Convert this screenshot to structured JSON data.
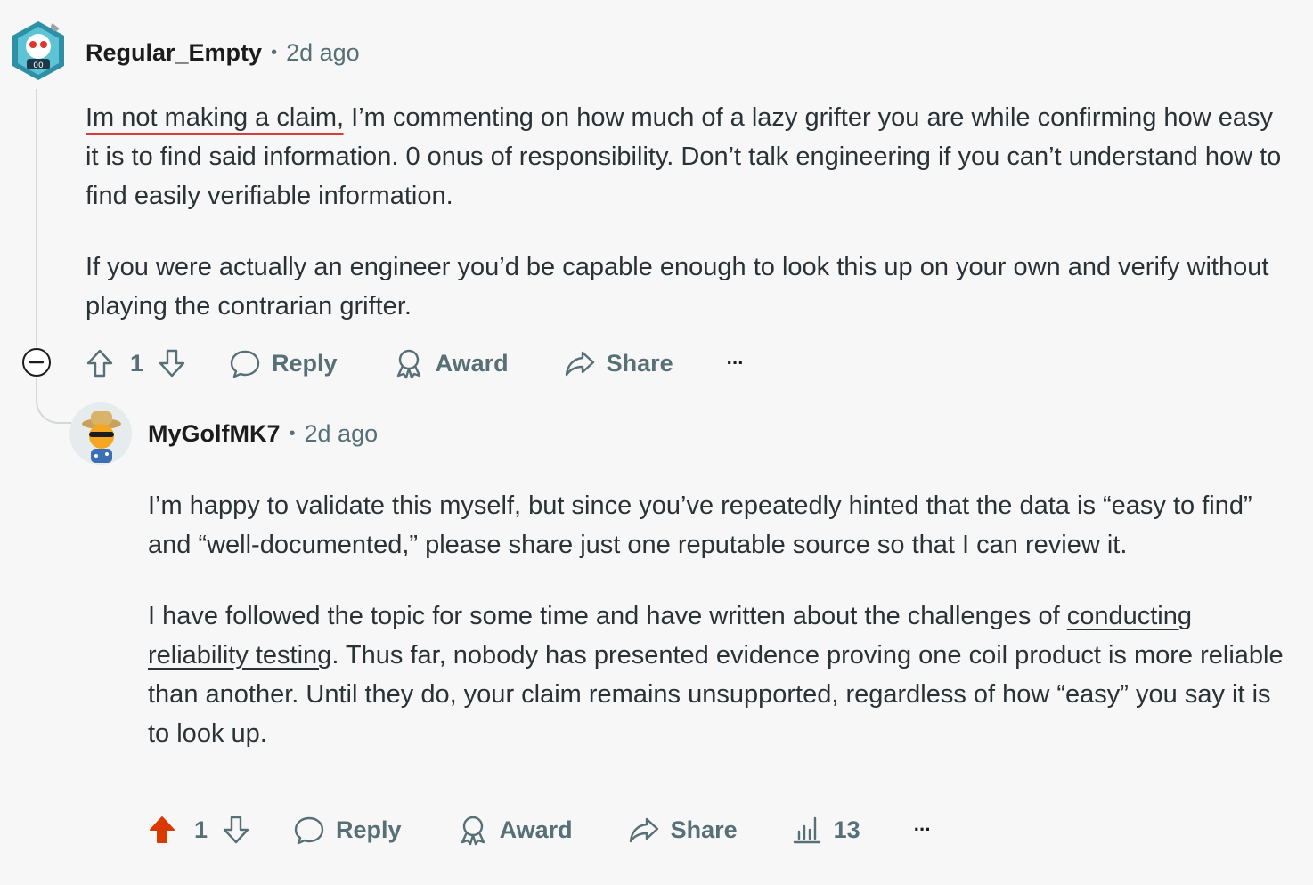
{
  "comments": [
    {
      "author": "Regular_Empty",
      "age": "2d ago",
      "paragraph1_claim": "Im not making a claim,",
      "paragraph1_rest": " I’m commenting on how much of a lazy grifter you are while confirming how easy it is to find said information. 0 onus of responsibility. Don’t talk engineering if you can’t understand how to find easily verifiable information.",
      "paragraph2": "If you were actually an engineer you’d be capable enough to look this up on your own and verify without playing the contrarian grifter.",
      "vote_count": "1",
      "reply_label": "Reply",
      "award_label": "Award",
      "share_label": "Share",
      "more_label": "···"
    },
    {
      "author": "MyGolfMK7",
      "age": "2d ago",
      "paragraph1": "I’m happy to validate this myself, but since you’ve repeatedly hinted that the data is “easy to find” and “well-documented,” please share just one reputable source so that I can review it.",
      "paragraph2_before": "I have followed the topic for some time and have written about the challenges of ",
      "paragraph2_link": "conducting reliability testing",
      "paragraph2_after": ". Thus far, nobody has presented evidence proving one coil product is more reliable than another. Until they do, your claim remains unsupported, regardless of how “easy” you say it is to look up.",
      "vote_count": "1",
      "upvoted": true,
      "reply_label": "Reply",
      "award_label": "Award",
      "share_label": "Share",
      "insights_count": "13",
      "more_label": "···"
    }
  ],
  "colors": {
    "upvote_active": "#d93a00",
    "meta_gray": "#576f76",
    "thread_line": "#d5d8da",
    "claim_underline": "#d93a3a"
  },
  "icons": [
    "collapse-icon",
    "upvote-icon",
    "downvote-icon",
    "reply-icon",
    "award-icon",
    "share-icon",
    "insights-icon",
    "more-icon"
  ]
}
